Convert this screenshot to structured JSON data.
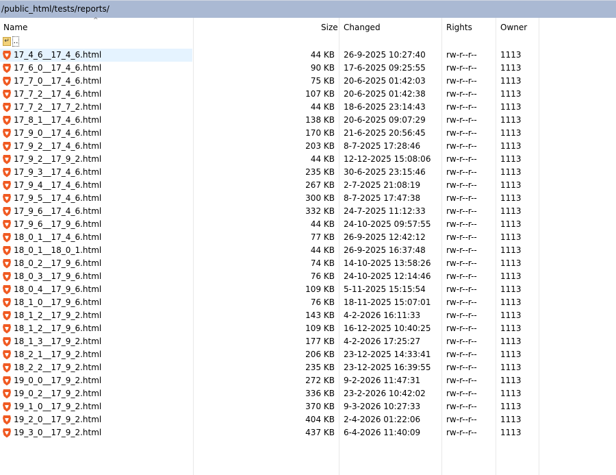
{
  "path": "/public_html/tests/reports/",
  "columns": {
    "name": "Name",
    "size": "Size",
    "changed": "Changed",
    "rights": "Rights",
    "owner": "Owner"
  },
  "parent_dir": "..",
  "files": [
    {
      "name": "17_4_6__17_4_6.html",
      "size": "44 KB",
      "changed": "26-9-2025 10:27:40",
      "rights": "rw-r--r--",
      "owner": "1113"
    },
    {
      "name": "17_6_0__17_4_6.html",
      "size": "90 KB",
      "changed": "17-6-2025 09:25:55",
      "rights": "rw-r--r--",
      "owner": "1113"
    },
    {
      "name": "17_7_0__17_4_6.html",
      "size": "75 KB",
      "changed": "20-6-2025 01:42:03",
      "rights": "rw-r--r--",
      "owner": "1113"
    },
    {
      "name": "17_7_2__17_4_6.html",
      "size": "107 KB",
      "changed": "20-6-2025 01:42:38",
      "rights": "rw-r--r--",
      "owner": "1113"
    },
    {
      "name": "17_7_2__17_7_2.html",
      "size": "44 KB",
      "changed": "18-6-2025 23:14:43",
      "rights": "rw-r--r--",
      "owner": "1113"
    },
    {
      "name": "17_8_1__17_4_6.html",
      "size": "138 KB",
      "changed": "20-6-2025 09:07:29",
      "rights": "rw-r--r--",
      "owner": "1113"
    },
    {
      "name": "17_9_0__17_4_6.html",
      "size": "170 KB",
      "changed": "21-6-2025 20:56:45",
      "rights": "rw-r--r--",
      "owner": "1113"
    },
    {
      "name": "17_9_2__17_4_6.html",
      "size": "203 KB",
      "changed": "8-7-2025 17:28:46",
      "rights": "rw-r--r--",
      "owner": "1113"
    },
    {
      "name": "17_9_2__17_9_2.html",
      "size": "44 KB",
      "changed": "12-12-2025 15:08:06",
      "rights": "rw-r--r--",
      "owner": "1113"
    },
    {
      "name": "17_9_3__17_4_6.html",
      "size": "235 KB",
      "changed": "30-6-2025 23:15:46",
      "rights": "rw-r--r--",
      "owner": "1113"
    },
    {
      "name": "17_9_4__17_4_6.html",
      "size": "267 KB",
      "changed": "2-7-2025 21:08:19",
      "rights": "rw-r--r--",
      "owner": "1113"
    },
    {
      "name": "17_9_5__17_4_6.html",
      "size": "300 KB",
      "changed": "8-7-2025 17:47:38",
      "rights": "rw-r--r--",
      "owner": "1113"
    },
    {
      "name": "17_9_6__17_4_6.html",
      "size": "332 KB",
      "changed": "24-7-2025 11:12:33",
      "rights": "rw-r--r--",
      "owner": "1113"
    },
    {
      "name": "17_9_6__17_9_6.html",
      "size": "44 KB",
      "changed": "24-10-2025 09:57:55",
      "rights": "rw-r--r--",
      "owner": "1113"
    },
    {
      "name": "18_0_1__17_4_6.html",
      "size": "77 KB",
      "changed": "26-9-2025 12:42:12",
      "rights": "rw-r--r--",
      "owner": "1113"
    },
    {
      "name": "18_0_1__18_0_1.html",
      "size": "44 KB",
      "changed": "26-9-2025 16:37:48",
      "rights": "rw-r--r--",
      "owner": "1113"
    },
    {
      "name": "18_0_2__17_9_6.html",
      "size": "74 KB",
      "changed": "14-10-2025 13:58:26",
      "rights": "rw-r--r--",
      "owner": "1113"
    },
    {
      "name": "18_0_3__17_9_6.html",
      "size": "76 KB",
      "changed": "24-10-2025 12:14:46",
      "rights": "rw-r--r--",
      "owner": "1113"
    },
    {
      "name": "18_0_4__17_9_6.html",
      "size": "109 KB",
      "changed": "5-11-2025 15:15:54",
      "rights": "rw-r--r--",
      "owner": "1113"
    },
    {
      "name": "18_1_0__17_9_6.html",
      "size": "76 KB",
      "changed": "18-11-2025 15:07:01",
      "rights": "rw-r--r--",
      "owner": "1113"
    },
    {
      "name": "18_1_2__17_9_2.html",
      "size": "143 KB",
      "changed": "4-2-2026 16:11:33",
      "rights": "rw-r--r--",
      "owner": "1113"
    },
    {
      "name": "18_1_2__17_9_6.html",
      "size": "109 KB",
      "changed": "16-12-2025 10:40:25",
      "rights": "rw-r--r--",
      "owner": "1113"
    },
    {
      "name": "18_1_3__17_9_2.html",
      "size": "177 KB",
      "changed": "4-2-2026 17:25:27",
      "rights": "rw-r--r--",
      "owner": "1113"
    },
    {
      "name": "18_2_1__17_9_2.html",
      "size": "206 KB",
      "changed": "23-12-2025 14:33:41",
      "rights": "rw-r--r--",
      "owner": "1113"
    },
    {
      "name": "18_2_2__17_9_2.html",
      "size": "235 KB",
      "changed": "23-12-2025 16:39:55",
      "rights": "rw-r--r--",
      "owner": "1113"
    },
    {
      "name": "19_0_0__17_9_2.html",
      "size": "272 KB",
      "changed": "9-2-2026 11:47:31",
      "rights": "rw-r--r--",
      "owner": "1113"
    },
    {
      "name": "19_0_2__17_9_2.html",
      "size": "336 KB",
      "changed": "23-2-2026 10:42:02",
      "rights": "rw-r--r--",
      "owner": "1113"
    },
    {
      "name": "19_1_0__17_9_2.html",
      "size": "370 KB",
      "changed": "9-3-2026 10:27:33",
      "rights": "rw-r--r--",
      "owner": "1113"
    },
    {
      "name": "19_2_0__17_9_2.html",
      "size": "404 KB",
      "changed": "2-4-2026 01:22:06",
      "rights": "rw-r--r--",
      "owner": "1113"
    },
    {
      "name": "19_3_0__17_9_2.html",
      "size": "437 KB",
      "changed": "6-4-2026 11:40:09",
      "rights": "rw-r--r--",
      "owner": "1113"
    }
  ],
  "selected_index": 0,
  "colors": {
    "pathbar": "#aab9d3",
    "selected_row": "#e5f3ff",
    "file_icon": "#f05a22"
  },
  "icons": {
    "file": "brave-browser-html-icon",
    "parent": "parent-folder-icon",
    "sort": "sort-ascending-icon"
  }
}
